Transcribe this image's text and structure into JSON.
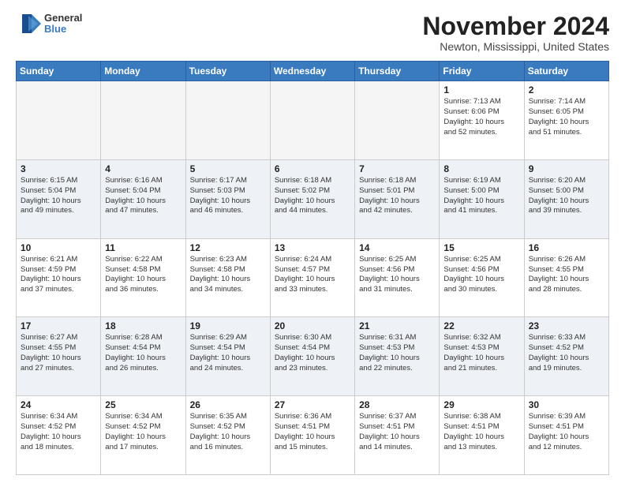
{
  "logo": {
    "general": "General",
    "blue": "Blue"
  },
  "title": "November 2024",
  "location": "Newton, Mississippi, United States",
  "days_header": [
    "Sunday",
    "Monday",
    "Tuesday",
    "Wednesday",
    "Thursday",
    "Friday",
    "Saturday"
  ],
  "weeks": [
    {
      "row_class": "row-even",
      "days": [
        {
          "num": "",
          "empty": true
        },
        {
          "num": "",
          "empty": true
        },
        {
          "num": "",
          "empty": true
        },
        {
          "num": "",
          "empty": true
        },
        {
          "num": "",
          "empty": true
        },
        {
          "num": "1",
          "empty": false,
          "info": "Sunrise: 7:13 AM\nSunset: 6:06 PM\nDaylight: 10 hours\nand 52 minutes."
        },
        {
          "num": "2",
          "empty": false,
          "info": "Sunrise: 7:14 AM\nSunset: 6:05 PM\nDaylight: 10 hours\nand 51 minutes."
        }
      ]
    },
    {
      "row_class": "row-odd",
      "days": [
        {
          "num": "3",
          "empty": false,
          "info": "Sunrise: 6:15 AM\nSunset: 5:04 PM\nDaylight: 10 hours\nand 49 minutes."
        },
        {
          "num": "4",
          "empty": false,
          "info": "Sunrise: 6:16 AM\nSunset: 5:04 PM\nDaylight: 10 hours\nand 47 minutes."
        },
        {
          "num": "5",
          "empty": false,
          "info": "Sunrise: 6:17 AM\nSunset: 5:03 PM\nDaylight: 10 hours\nand 46 minutes."
        },
        {
          "num": "6",
          "empty": false,
          "info": "Sunrise: 6:18 AM\nSunset: 5:02 PM\nDaylight: 10 hours\nand 44 minutes."
        },
        {
          "num": "7",
          "empty": false,
          "info": "Sunrise: 6:18 AM\nSunset: 5:01 PM\nDaylight: 10 hours\nand 42 minutes."
        },
        {
          "num": "8",
          "empty": false,
          "info": "Sunrise: 6:19 AM\nSunset: 5:00 PM\nDaylight: 10 hours\nand 41 minutes."
        },
        {
          "num": "9",
          "empty": false,
          "info": "Sunrise: 6:20 AM\nSunset: 5:00 PM\nDaylight: 10 hours\nand 39 minutes."
        }
      ]
    },
    {
      "row_class": "row-even",
      "days": [
        {
          "num": "10",
          "empty": false,
          "info": "Sunrise: 6:21 AM\nSunset: 4:59 PM\nDaylight: 10 hours\nand 37 minutes."
        },
        {
          "num": "11",
          "empty": false,
          "info": "Sunrise: 6:22 AM\nSunset: 4:58 PM\nDaylight: 10 hours\nand 36 minutes."
        },
        {
          "num": "12",
          "empty": false,
          "info": "Sunrise: 6:23 AM\nSunset: 4:58 PM\nDaylight: 10 hours\nand 34 minutes."
        },
        {
          "num": "13",
          "empty": false,
          "info": "Sunrise: 6:24 AM\nSunset: 4:57 PM\nDaylight: 10 hours\nand 33 minutes."
        },
        {
          "num": "14",
          "empty": false,
          "info": "Sunrise: 6:25 AM\nSunset: 4:56 PM\nDaylight: 10 hours\nand 31 minutes."
        },
        {
          "num": "15",
          "empty": false,
          "info": "Sunrise: 6:25 AM\nSunset: 4:56 PM\nDaylight: 10 hours\nand 30 minutes."
        },
        {
          "num": "16",
          "empty": false,
          "info": "Sunrise: 6:26 AM\nSunset: 4:55 PM\nDaylight: 10 hours\nand 28 minutes."
        }
      ]
    },
    {
      "row_class": "row-odd",
      "days": [
        {
          "num": "17",
          "empty": false,
          "info": "Sunrise: 6:27 AM\nSunset: 4:55 PM\nDaylight: 10 hours\nand 27 minutes."
        },
        {
          "num": "18",
          "empty": false,
          "info": "Sunrise: 6:28 AM\nSunset: 4:54 PM\nDaylight: 10 hours\nand 26 minutes."
        },
        {
          "num": "19",
          "empty": false,
          "info": "Sunrise: 6:29 AM\nSunset: 4:54 PM\nDaylight: 10 hours\nand 24 minutes."
        },
        {
          "num": "20",
          "empty": false,
          "info": "Sunrise: 6:30 AM\nSunset: 4:54 PM\nDaylight: 10 hours\nand 23 minutes."
        },
        {
          "num": "21",
          "empty": false,
          "info": "Sunrise: 6:31 AM\nSunset: 4:53 PM\nDaylight: 10 hours\nand 22 minutes."
        },
        {
          "num": "22",
          "empty": false,
          "info": "Sunrise: 6:32 AM\nSunset: 4:53 PM\nDaylight: 10 hours\nand 21 minutes."
        },
        {
          "num": "23",
          "empty": false,
          "info": "Sunrise: 6:33 AM\nSunset: 4:52 PM\nDaylight: 10 hours\nand 19 minutes."
        }
      ]
    },
    {
      "row_class": "row-even",
      "days": [
        {
          "num": "24",
          "empty": false,
          "info": "Sunrise: 6:34 AM\nSunset: 4:52 PM\nDaylight: 10 hours\nand 18 minutes."
        },
        {
          "num": "25",
          "empty": false,
          "info": "Sunrise: 6:34 AM\nSunset: 4:52 PM\nDaylight: 10 hours\nand 17 minutes."
        },
        {
          "num": "26",
          "empty": false,
          "info": "Sunrise: 6:35 AM\nSunset: 4:52 PM\nDaylight: 10 hours\nand 16 minutes."
        },
        {
          "num": "27",
          "empty": false,
          "info": "Sunrise: 6:36 AM\nSunset: 4:51 PM\nDaylight: 10 hours\nand 15 minutes."
        },
        {
          "num": "28",
          "empty": false,
          "info": "Sunrise: 6:37 AM\nSunset: 4:51 PM\nDaylight: 10 hours\nand 14 minutes."
        },
        {
          "num": "29",
          "empty": false,
          "info": "Sunrise: 6:38 AM\nSunset: 4:51 PM\nDaylight: 10 hours\nand 13 minutes."
        },
        {
          "num": "30",
          "empty": false,
          "info": "Sunrise: 6:39 AM\nSunset: 4:51 PM\nDaylight: 10 hours\nand 12 minutes."
        }
      ]
    }
  ]
}
